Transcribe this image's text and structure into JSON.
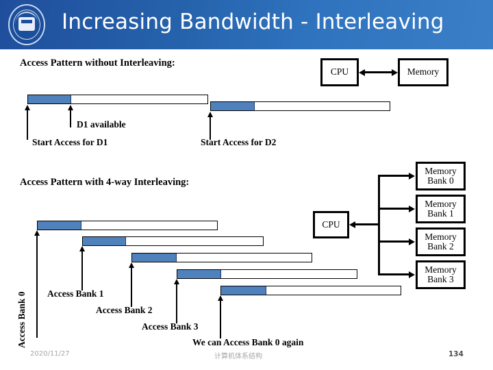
{
  "header": {
    "title": "Increasing Bandwidth - Interleaving",
    "logo_icon": "university-seal-icon",
    "bg_start": "#1f4e9c",
    "bg_end": "#3a7fc8"
  },
  "section1": {
    "heading": "Access Pattern without Interleaving:",
    "cpu_box": "CPU",
    "memory_box": "Memory",
    "labels": {
      "d1_available": "D1 available",
      "start_d1": "Start Access for D1",
      "start_d2": "Start Access for D2"
    }
  },
  "section2": {
    "heading": "Access Pattern with 4-way Interleaving:",
    "cpu_box": "CPU",
    "banks": [
      {
        "line1": "Memory",
        "line2": "Bank 0"
      },
      {
        "line1": "Memory",
        "line2": "Bank 1"
      },
      {
        "line1": "Memory",
        "line2": "Bank 2"
      },
      {
        "line1": "Memory",
        "line2": "Bank 3"
      }
    ],
    "labels": {
      "access_bank_0": "Access Bank 0",
      "access_bank_1": "Access Bank 1",
      "access_bank_2": "Access Bank 2",
      "access_bank_3": "Access Bank 3",
      "again": "We can Access Bank 0 again"
    }
  },
  "colors": {
    "bar_fill": "#4F81BD",
    "bar_border": "#000000"
  },
  "footer": {
    "date": "2020/11/27",
    "course": "计算机体系结构",
    "page": "134"
  }
}
